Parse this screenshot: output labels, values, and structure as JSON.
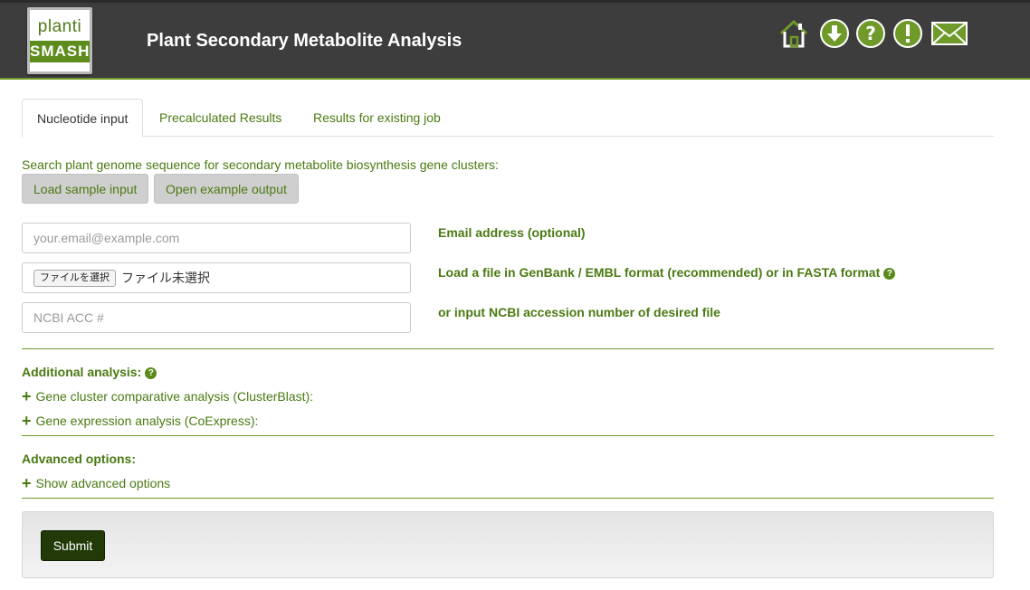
{
  "header": {
    "logo_top": "planti",
    "logo_bottom": "SMASH",
    "title": "Plant Secondary Metabolite Analysis",
    "icons": [
      "home-icon",
      "download-icon",
      "help-icon",
      "alert-icon",
      "mail-icon"
    ],
    "accent": "#6f9a2a"
  },
  "tabs": [
    {
      "label": "Nucleotide input",
      "active": true
    },
    {
      "label": "Precalculated Results",
      "active": false
    },
    {
      "label": "Results for existing job",
      "active": false
    }
  ],
  "intro": "Search plant genome sequence for secondary metabolite biosynthesis gene clusters:",
  "buttons": {
    "load_sample": "Load sample input",
    "open_example": "Open example output",
    "submit": "Submit"
  },
  "fields": {
    "email": {
      "placeholder": "your.email@example.com",
      "value": "",
      "label": "Email address (optional)"
    },
    "file": {
      "button": "ファイルを選択",
      "status": "ファイル未選択",
      "label": "Load a file in GenBank / EMBL format (recommended) or in FASTA format"
    },
    "accession": {
      "placeholder": "NCBI ACC #",
      "value": "",
      "label": "or input NCBI accession number of desired file"
    }
  },
  "additional": {
    "title": "Additional analysis:",
    "items": [
      "Gene cluster comparative analysis (ClusterBlast):",
      "Gene expression analysis (CoExpress):"
    ]
  },
  "advanced": {
    "title": "Advanced options:",
    "toggle": "Show advanced options"
  },
  "help_glyph": "?",
  "plus_glyph": "+"
}
